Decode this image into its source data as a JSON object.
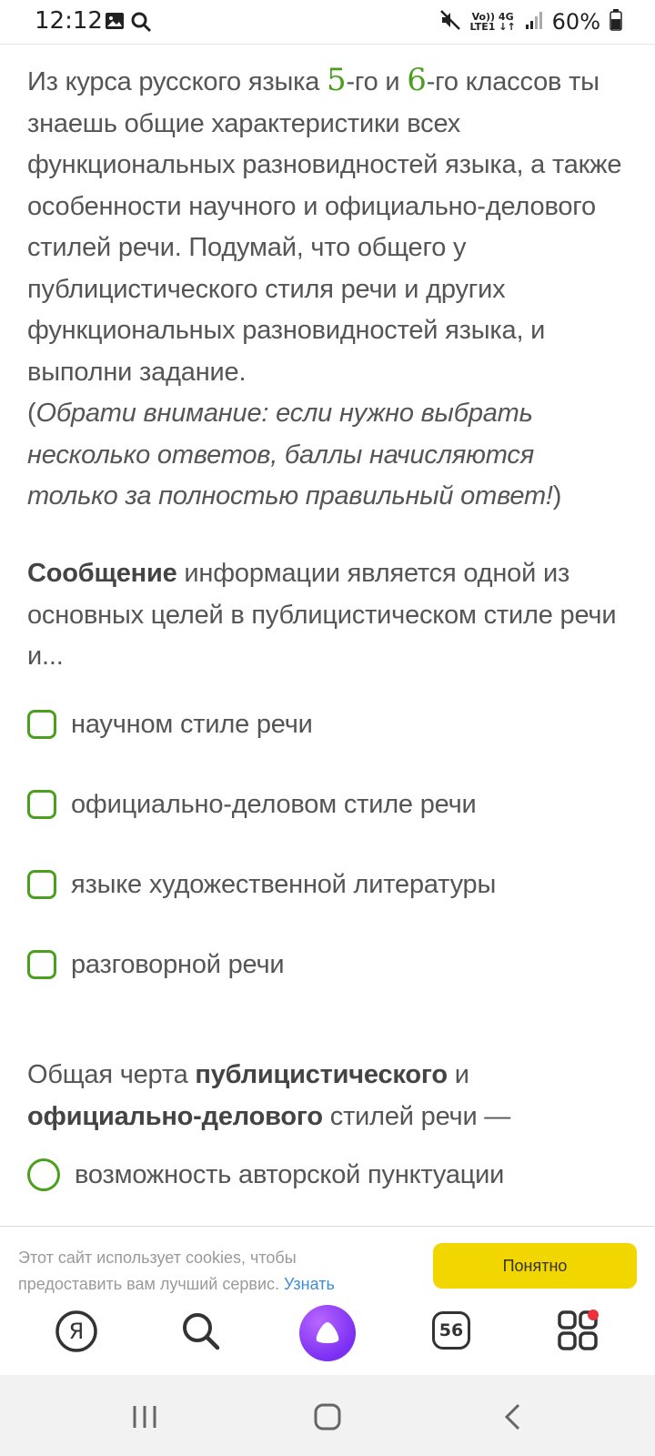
{
  "status_bar": {
    "time": "12:12",
    "net_top": "Vo)) 4G",
    "net_bottom": "LTE1 ↓↑",
    "battery": "60%"
  },
  "intro": {
    "p1": "Из курса русского языка ",
    "n1": "5",
    "p2": "-го и ",
    "n2": "6",
    "p3": "-го классов ты знаешь общие характеристики всех функциональных разновидностей языка, а также особенности научного и официально-делового стилей речи. Подумай, что общего у публицистического стиля речи и других функциональных разновидностей языка, и выполни задание.",
    "note_open": "(",
    "note": "Обрати внимание: если нужно выбрать несколько ответов, баллы начисляются только за полностью правильный ответ!",
    "note_close": ")"
  },
  "question1": {
    "bold": "Сообщение",
    "text": " информации является одной из основных целей в публицистическом стиле речи и...",
    "options": [
      "научном стиле речи",
      "официально-деловом стиле речи",
      "языке художественной литературы",
      "разговорной речи"
    ]
  },
  "question2": {
    "t1": "Общая черта ",
    "b1": "публицистического",
    "t2": " и ",
    "b2": "официально-делового",
    "t3": " стилей речи —",
    "options": [
      "возможность авторской пунктуации"
    ]
  },
  "cookie": {
    "text": "Этот сайт использует cookies, чтобы предоставить вам лучший сервис. ",
    "link": "Узнать",
    "button": "Понятно"
  },
  "browser_bar": {
    "tabs_count": "56"
  },
  "colors": {
    "accent_green": "#4aa01e",
    "cookie_button": "#f2d600",
    "alice_purple": "#7b2ff2"
  }
}
